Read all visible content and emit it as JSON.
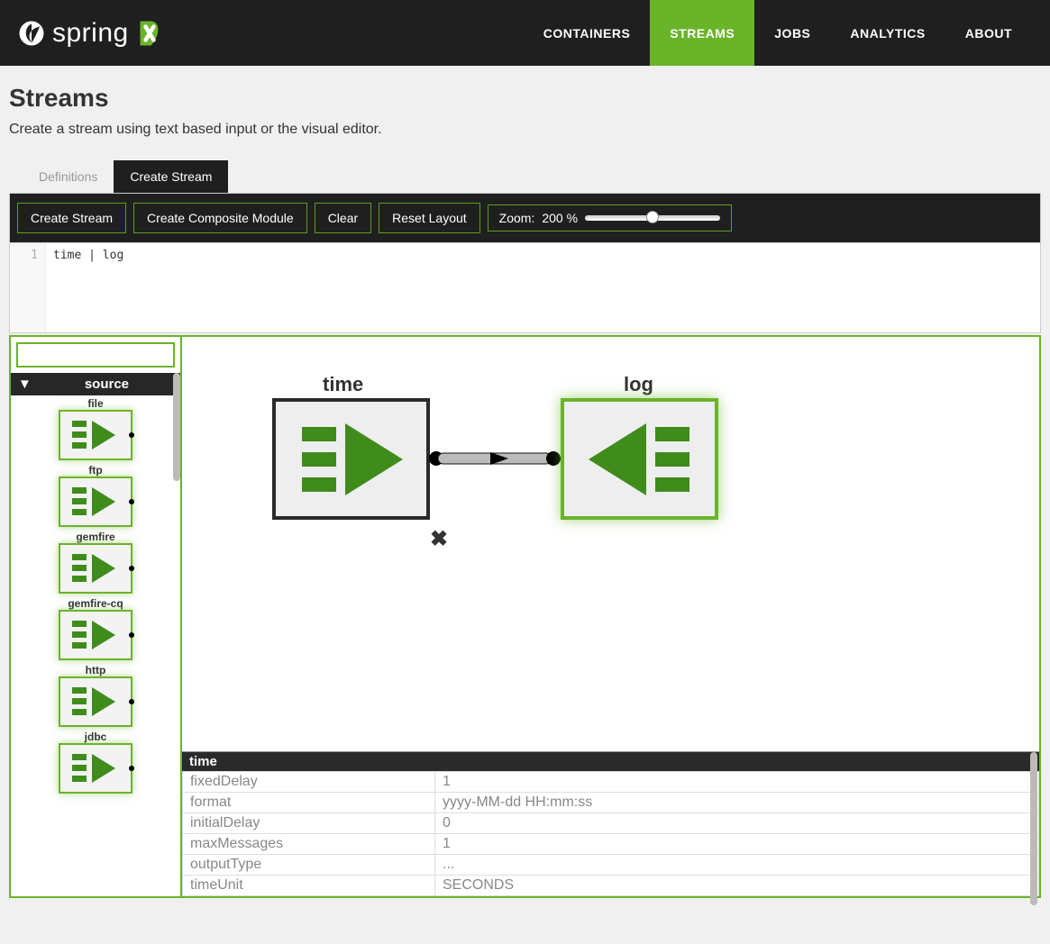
{
  "brand": {
    "name": "spring"
  },
  "nav": [
    {
      "label": "CONTAINERS",
      "active": false
    },
    {
      "label": "STREAMS",
      "active": true
    },
    {
      "label": "JOBS",
      "active": false
    },
    {
      "label": "ANALYTICS",
      "active": false
    },
    {
      "label": "ABOUT",
      "active": false
    }
  ],
  "page": {
    "title": "Streams",
    "subtitle": "Create a stream using text based input or the visual editor."
  },
  "tabs": [
    {
      "label": "Definitions",
      "active": false
    },
    {
      "label": "Create Stream",
      "active": true
    }
  ],
  "toolbar": {
    "create": "Create Stream",
    "composite": "Create Composite Module",
    "clear": "Clear",
    "reset": "Reset Layout",
    "zoom_label": "Zoom:",
    "zoom_value": "200 %"
  },
  "editor": {
    "line_number": "1",
    "code": "time | log"
  },
  "palette": {
    "section": "source",
    "items": [
      "file",
      "ftp",
      "gemfire",
      "gemfire-cq",
      "http",
      "jdbc"
    ]
  },
  "canvas": {
    "nodes": [
      {
        "name": "time",
        "type": "source",
        "selected": true
      },
      {
        "name": "log",
        "type": "sink",
        "selected": false
      }
    ]
  },
  "properties": {
    "title": "time",
    "rows": [
      {
        "key": "fixedDelay",
        "value": "1"
      },
      {
        "key": "format",
        "value": "yyyy-MM-dd HH:mm:ss"
      },
      {
        "key": "initialDelay",
        "value": "0"
      },
      {
        "key": "maxMessages",
        "value": "1"
      },
      {
        "key": "outputType",
        "value": "..."
      },
      {
        "key": "timeUnit",
        "value": "SECONDS"
      }
    ]
  }
}
